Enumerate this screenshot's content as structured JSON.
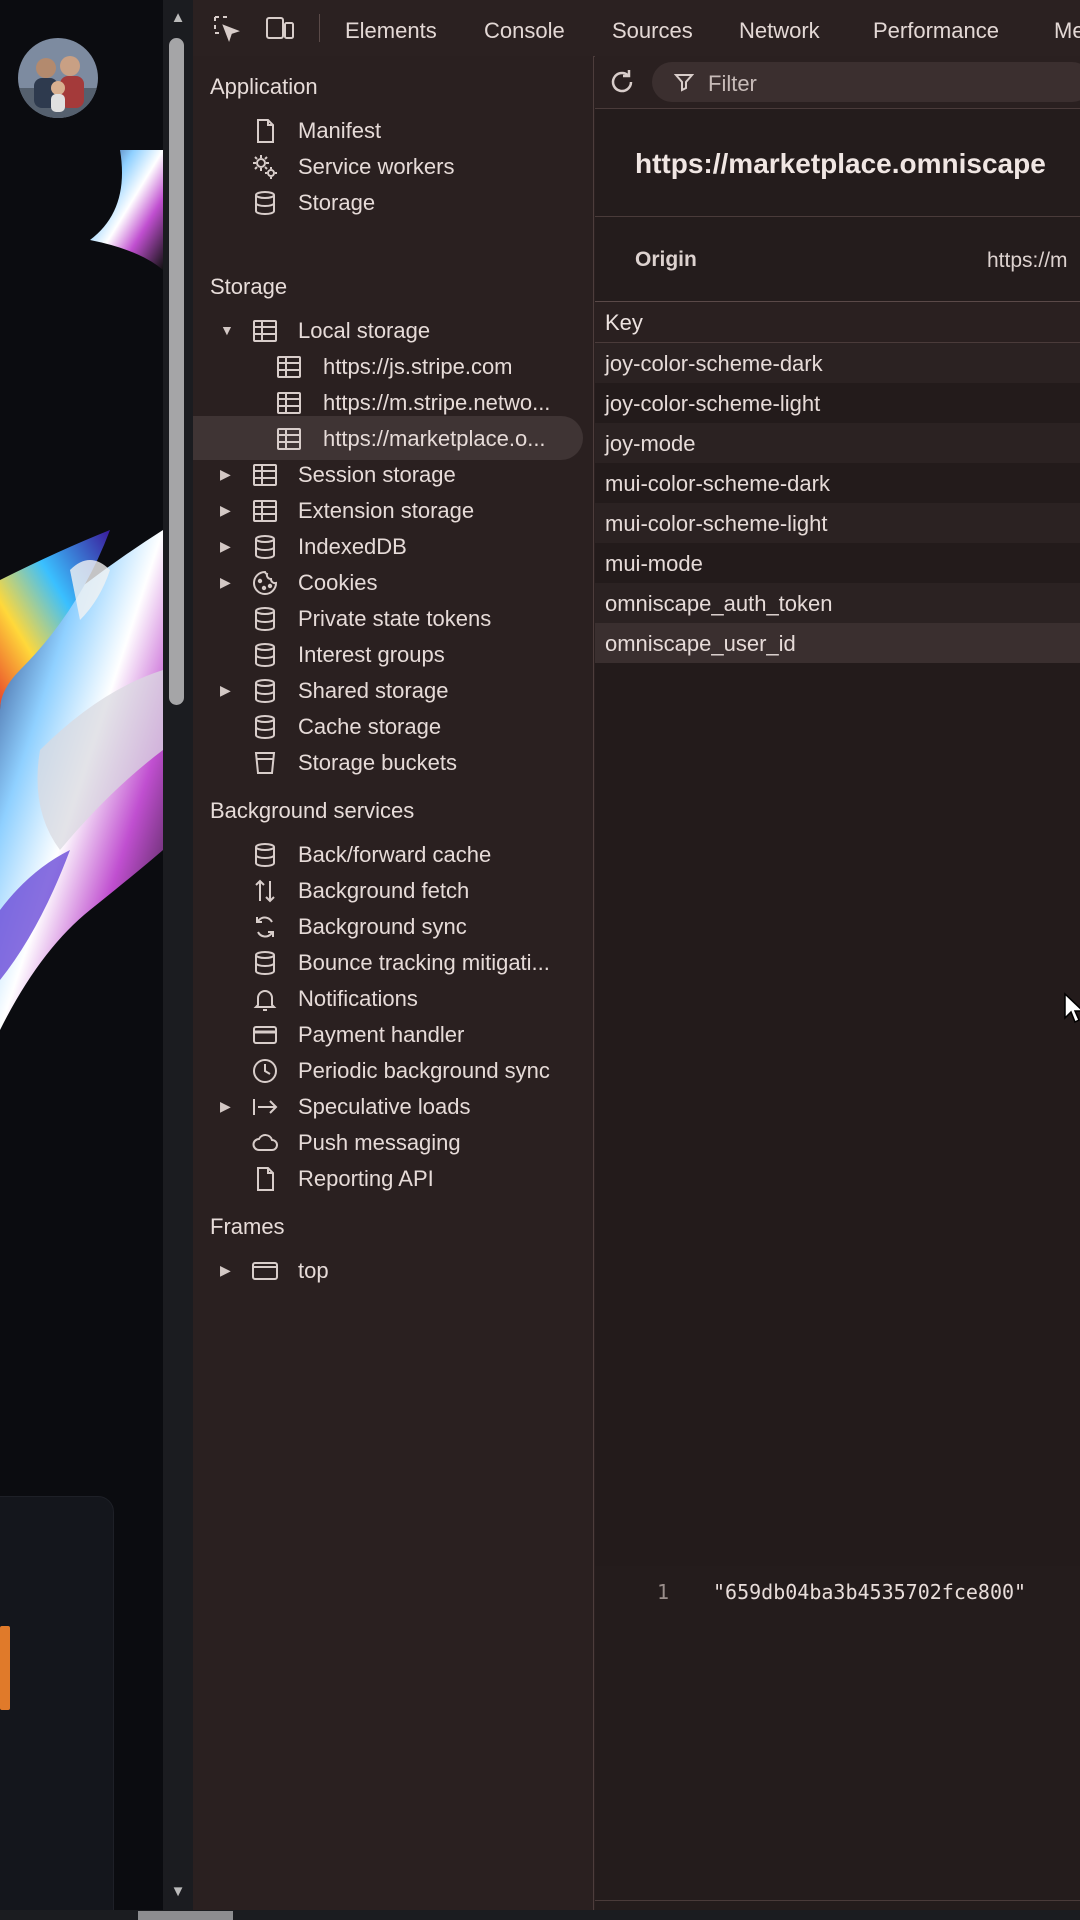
{
  "toolbar": {
    "tabs": [
      "Elements",
      "Console",
      "Sources",
      "Network",
      "Performance",
      "Me"
    ]
  },
  "sidebar": {
    "application": {
      "title": "Application",
      "items": [
        {
          "label": "Manifest",
          "icon": "file-icon"
        },
        {
          "label": "Service workers",
          "icon": "gears-icon"
        },
        {
          "label": "Storage",
          "icon": "database-icon"
        }
      ]
    },
    "storage": {
      "title": "Storage",
      "local_storage": {
        "label": "Local storage",
        "children": [
          "https://js.stripe.com",
          "https://m.stripe.netwo...",
          "https://marketplace.o..."
        ]
      },
      "items": [
        {
          "label": "Session storage",
          "icon": "table-icon",
          "expandable": true
        },
        {
          "label": "Extension storage",
          "icon": "table-icon",
          "expandable": true
        },
        {
          "label": "IndexedDB",
          "icon": "database-icon",
          "expandable": true
        },
        {
          "label": "Cookies",
          "icon": "cookie-icon",
          "expandable": true
        },
        {
          "label": "Private state tokens",
          "icon": "database-icon",
          "expandable": false
        },
        {
          "label": "Interest groups",
          "icon": "database-icon",
          "expandable": false
        },
        {
          "label": "Shared storage",
          "icon": "database-icon",
          "expandable": true
        },
        {
          "label": "Cache storage",
          "icon": "database-icon",
          "expandable": false
        },
        {
          "label": "Storage buckets",
          "icon": "bucket-icon",
          "expandable": false
        }
      ]
    },
    "background": {
      "title": "Background services",
      "items": [
        {
          "label": "Back/forward cache",
          "icon": "database-icon"
        },
        {
          "label": "Background fetch",
          "icon": "up-down-arrows-icon"
        },
        {
          "label": "Background sync",
          "icon": "sync-icon"
        },
        {
          "label": "Bounce tracking mitigati...",
          "icon": "database-icon"
        },
        {
          "label": "Notifications",
          "icon": "bell-icon"
        },
        {
          "label": "Payment handler",
          "icon": "card-icon"
        },
        {
          "label": "Periodic background sync",
          "icon": "clock-icon"
        },
        {
          "label": "Speculative loads",
          "icon": "arrow-right-bar-icon"
        },
        {
          "label": "Push messaging",
          "icon": "cloud-icon"
        },
        {
          "label": "Reporting API",
          "icon": "file-icon"
        }
      ]
    },
    "frames": {
      "title": "Frames",
      "items": [
        {
          "label": "top",
          "icon": "frame-icon"
        }
      ]
    }
  },
  "main": {
    "filter_placeholder": "Filter",
    "origin_title": "https://marketplace.omniscape",
    "origin_label": "Origin",
    "origin_value": "https://m",
    "key_header": "Key",
    "keys": [
      "joy-color-scheme-dark",
      "joy-color-scheme-light",
      "joy-mode",
      "mui-color-scheme-dark",
      "mui-color-scheme-light",
      "mui-mode",
      "omniscape_auth_token",
      "omniscape_user_id"
    ],
    "selected_key": "omniscape_user_id",
    "preview": {
      "line_number": "1",
      "value": "\"659db04ba3b4535702fce800\""
    }
  },
  "colors": {
    "devtools_bg": "#2a2020",
    "selected_row": "#3a2f2f",
    "text": "#e6dbd8"
  }
}
